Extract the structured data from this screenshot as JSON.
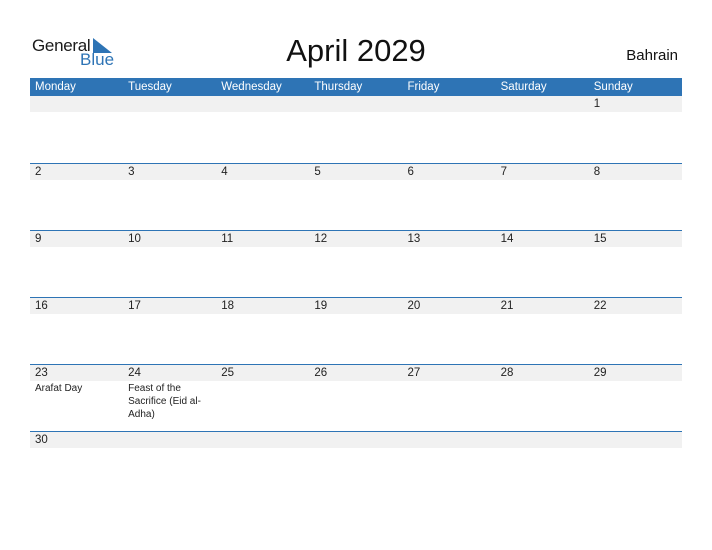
{
  "logo": {
    "word1": "General",
    "word2": "Blue",
    "icon": "triangle-flag-icon"
  },
  "title": "April 2029",
  "country": "Bahrain",
  "colors": {
    "accent": "#2E74B5",
    "strip": "#F1F1F1"
  },
  "weekdays": [
    "Monday",
    "Tuesday",
    "Wednesday",
    "Thursday",
    "Friday",
    "Saturday",
    "Sunday"
  ],
  "weeks": [
    [
      {
        "d": ""
      },
      {
        "d": ""
      },
      {
        "d": ""
      },
      {
        "d": ""
      },
      {
        "d": ""
      },
      {
        "d": ""
      },
      {
        "d": "1"
      }
    ],
    [
      {
        "d": "2"
      },
      {
        "d": "3"
      },
      {
        "d": "4"
      },
      {
        "d": "5"
      },
      {
        "d": "6"
      },
      {
        "d": "7"
      },
      {
        "d": "8"
      }
    ],
    [
      {
        "d": "9"
      },
      {
        "d": "10"
      },
      {
        "d": "11"
      },
      {
        "d": "12"
      },
      {
        "d": "13"
      },
      {
        "d": "14"
      },
      {
        "d": "15"
      }
    ],
    [
      {
        "d": "16"
      },
      {
        "d": "17"
      },
      {
        "d": "18"
      },
      {
        "d": "19"
      },
      {
        "d": "20"
      },
      {
        "d": "21"
      },
      {
        "d": "22"
      }
    ],
    [
      {
        "d": "23",
        "e": "Arafat Day"
      },
      {
        "d": "24",
        "e": "Feast of the Sacrifice (Eid al-Adha)"
      },
      {
        "d": "25"
      },
      {
        "d": "26"
      },
      {
        "d": "27"
      },
      {
        "d": "28"
      },
      {
        "d": "29"
      }
    ],
    [
      {
        "d": "30"
      },
      {
        "d": ""
      },
      {
        "d": ""
      },
      {
        "d": ""
      },
      {
        "d": ""
      },
      {
        "d": ""
      },
      {
        "d": ""
      }
    ]
  ]
}
